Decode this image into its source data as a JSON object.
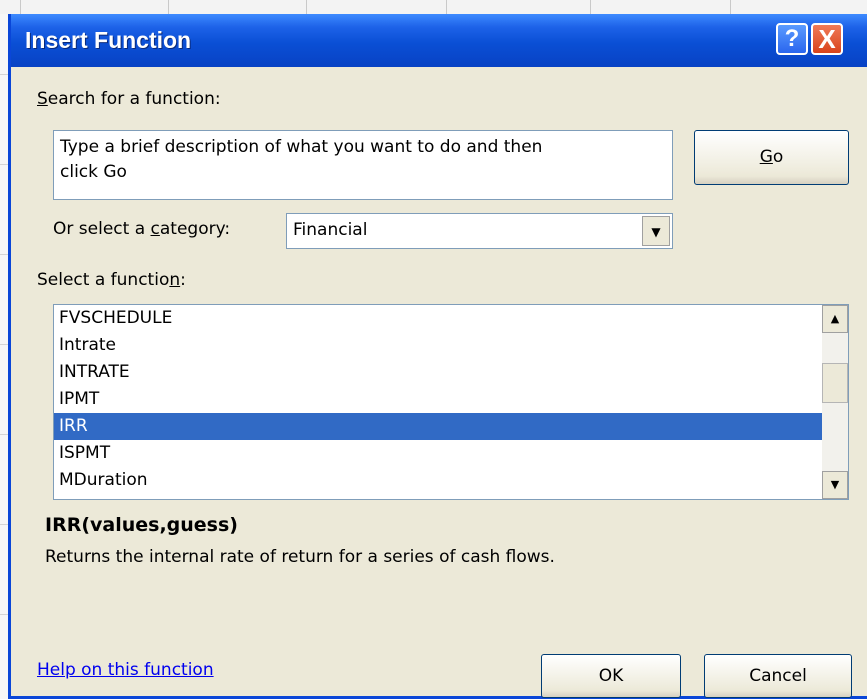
{
  "dialog": {
    "title": "Insert Function",
    "help_button_glyph": "?",
    "close_button_glyph": "X"
  },
  "search": {
    "label": "Search for a function:",
    "label_mnemonic": "S",
    "label_rest": "earch for a function:",
    "input_value": "Type a brief description of what you want to do and then\nclick Go",
    "go_label": "Go",
    "go_mnemonic": "G",
    "go_rest": "o"
  },
  "category": {
    "label_prefix": "Or select a ",
    "label_mnemonic": "c",
    "label_rest": "ategory:",
    "selected": "Financial",
    "dropdown_icon": "chevron-down-icon"
  },
  "function_list": {
    "label_prefix": "Select a functio",
    "label_mnemonic": "n",
    "label_rest": ":",
    "items": [
      "FVSCHEDULE",
      "Intrate",
      "INTRATE",
      "IPMT",
      "IRR",
      "ISPMT",
      "MDuration"
    ],
    "selected_index": 4
  },
  "details": {
    "signature": "IRR(values,guess)",
    "description": "Returns the internal rate of return for a series of cash flows."
  },
  "footer": {
    "help_link": "Help on this function",
    "ok_label": "OK",
    "cancel_label": "Cancel"
  },
  "colors": {
    "title_bar": "#0a4fd5",
    "dialog_face": "#ece9d8",
    "selection": "#316ac5",
    "link": "#0000ee"
  }
}
